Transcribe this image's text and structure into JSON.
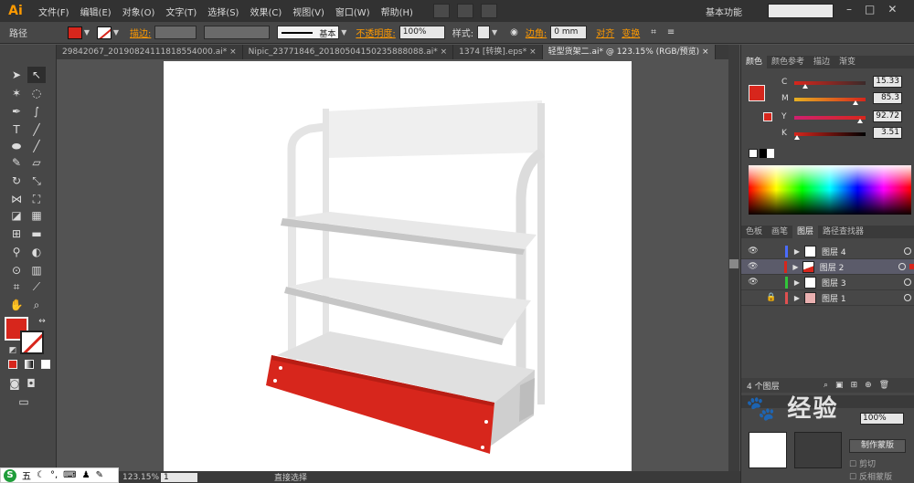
{
  "app": {
    "logo": "Ai"
  },
  "menu": [
    "文件(F)",
    "编辑(E)",
    "对象(O)",
    "文字(T)",
    "选择(S)",
    "效果(C)",
    "视图(V)",
    "窗口(W)",
    "帮助(H)"
  ],
  "workspace": "基本功能",
  "control_bar": {
    "selection_type": "路径",
    "stroke_label": "描边:",
    "stroke_style": "基本",
    "opacity_label": "不透明度:",
    "opacity_value": "100%",
    "style_label": "样式:",
    "corner_label": "边角:",
    "corner_value": "0 mm",
    "align_label": "对齐",
    "transform_label": "变换"
  },
  "doc_tabs": [
    {
      "label": "29842067_20190824111818554000.ai*",
      "active": false
    },
    {
      "label": "Nipic_23771846_20180504150235888088.ai*",
      "active": false
    },
    {
      "label": "1374 [转换].eps*",
      "active": false
    },
    {
      "label": "轻型货架二.ai* @ 123.15% (RGB/预览)",
      "active": true
    }
  ],
  "status": {
    "zoom": "123.15%",
    "artboard": "1",
    "tool": "直接选择"
  },
  "color_panel": {
    "tabs": [
      "颜色",
      "颜色参考",
      "描边",
      "渐变"
    ],
    "channels": [
      {
        "name": "C",
        "value": "15.33",
        "fraction": 0.1533
      },
      {
        "name": "M",
        "value": "85.3",
        "fraction": 0.853
      },
      {
        "name": "Y",
        "value": "92.72",
        "fraction": 0.9272
      },
      {
        "name": "K",
        "value": "3.51",
        "fraction": 0.0351
      }
    ]
  },
  "layers_panel": {
    "tabs": [
      "色板",
      "画笔",
      "图层",
      "路径查找器"
    ],
    "layers": [
      {
        "name": "图层 4",
        "color": "#4a6cff",
        "locked": false,
        "selected": false
      },
      {
        "name": "图层 2",
        "color": "#d7261c",
        "locked": false,
        "selected": true
      },
      {
        "name": "图层 3",
        "color": "#31c53a",
        "locked": false,
        "selected": false
      },
      {
        "name": "图层 1",
        "color": "#e05050",
        "locked": true,
        "selected": false
      }
    ],
    "count_label": "4 个图层"
  },
  "transparency_panel": {
    "opacity": "100%",
    "mask_button": "制作蒙版",
    "clip_label": "剪切",
    "invert_label": "反相蒙版"
  },
  "colors": {
    "fill": "#d7261c",
    "accent": "#ff9a00"
  }
}
